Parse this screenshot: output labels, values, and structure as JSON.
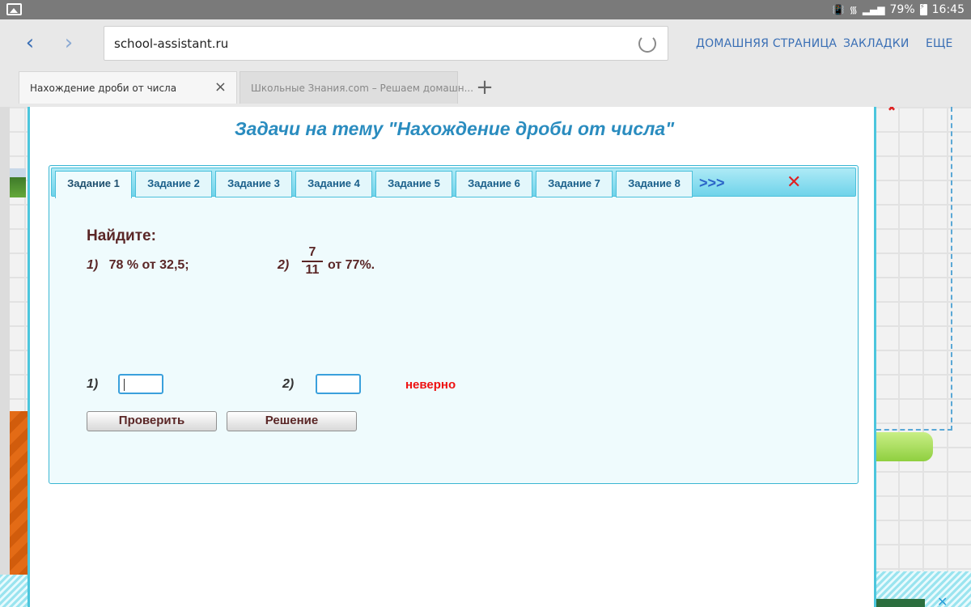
{
  "status_bar": {
    "battery": "79%",
    "time": "16:45",
    "icons": [
      "gallery-icon",
      "vibrate-icon",
      "wifi-icon",
      "signal-icon",
      "battery-charging-icon"
    ]
  },
  "browser": {
    "url": "school-assistant.ru",
    "links": {
      "home": "ДОМАШНЯЯ СТРАНИЦА",
      "bookmarks": "ЗАКЛАДКИ",
      "more": "ЕЩЕ"
    },
    "tabs": [
      {
        "title": "Нахождение дроби от числа",
        "active": true
      },
      {
        "title": "Школьные Знания.com – Решаем домашн...",
        "active": false
      }
    ],
    "new_tab": "+",
    "close_tab": "×"
  },
  "dialog": {
    "title": "Задачи на тему \"Нахождение дроби от числа\"",
    "tabs": [
      "Задание 1",
      "Задание 2",
      "Задание 3",
      "Задание 4",
      "Задание 5",
      "Задание 6",
      "Задание 7",
      "Задание 8"
    ],
    "active_tab": "Задание 1",
    "more": ">>>",
    "close": "✕",
    "find_heading": "Найдите:",
    "task1": {
      "num": "1)",
      "text": "78 % от  32,5;"
    },
    "task2": {
      "num": "2)",
      "numerator": "7",
      "denominator": "11",
      "text": "от  77%."
    },
    "answers": [
      {
        "label": "1)",
        "value": ""
      },
      {
        "label": "2)",
        "value": ""
      }
    ],
    "verdict": "неверно",
    "buttons": {
      "check": "Проверить",
      "solution": "Решение"
    }
  },
  "colors": {
    "accent": "#2a8cbf",
    "tab_bar": "#6fd3ea",
    "panel_bg": "#effbfd",
    "error": "#ee1111",
    "text_brown": "#5a2626"
  }
}
